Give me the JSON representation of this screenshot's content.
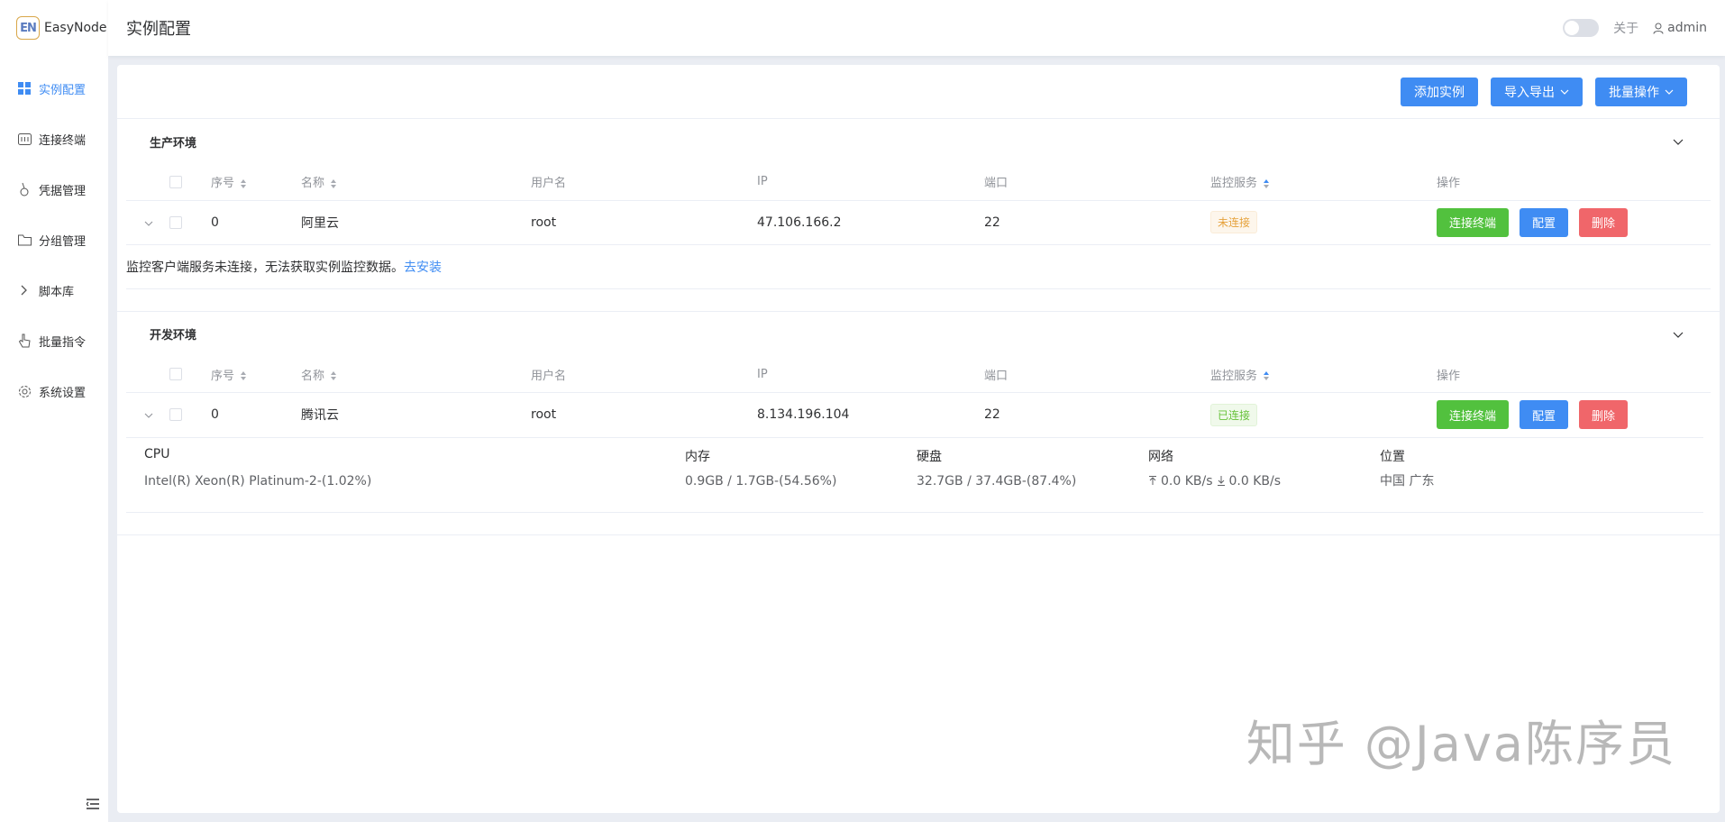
{
  "app": {
    "logo_badge": "EN",
    "name": "EasyNode"
  },
  "sidebar": {
    "items": [
      {
        "label": "实例配置",
        "icon": "grid-icon",
        "active": true
      },
      {
        "label": "连接终端",
        "icon": "terminal-icon",
        "active": false
      },
      {
        "label": "凭据管理",
        "icon": "key-icon",
        "active": false
      },
      {
        "label": "分组管理",
        "icon": "folder-icon",
        "active": false
      },
      {
        "label": "脚本库",
        "icon": "chevron-right-icon",
        "active": false
      },
      {
        "label": "批量指令",
        "icon": "pointer-icon",
        "active": false
      },
      {
        "label": "系统设置",
        "icon": "gear-icon",
        "active": false
      }
    ]
  },
  "header": {
    "title": "实例配置",
    "about": "关于",
    "user": "admin"
  },
  "toolbar": {
    "add": "添加实例",
    "import_export": "导入导出",
    "batch": "批量操作"
  },
  "columns": {
    "index": "序号",
    "name": "名称",
    "username": "用户名",
    "ip": "IP",
    "port": "端口",
    "monitor": "监控服务",
    "actions": "操作"
  },
  "actions": {
    "connect": "连接终端",
    "config": "配置",
    "delete": "删除"
  },
  "groups": [
    {
      "title": "生产环境",
      "row": {
        "index": "0",
        "name": "阿里云",
        "username": "root",
        "ip": "47.106.166.2",
        "port": "22",
        "status": "未连接"
      },
      "notice": "监控客户端服务未连接，无法获取实例监控数据。",
      "notice_link": "去安装"
    },
    {
      "title": "开发环境",
      "row": {
        "index": "0",
        "name": "腾讯云",
        "username": "root",
        "ip": "8.134.196.104",
        "port": "22",
        "status": "已连接"
      },
      "detail": {
        "cpu_label": "CPU",
        "cpu_value": "Intel(R) Xeon(R) Platinum-2-(1.02%)",
        "mem_label": "内存",
        "mem_value": "0.9GB / 1.7GB-(54.56%)",
        "disk_label": "硬盘",
        "disk_value": "32.7GB / 37.4GB-(87.4%)",
        "net_label": "网络",
        "net_up": "0.0 KB/s",
        "net_down": "0.0 KB/s",
        "loc_label": "位置",
        "loc_value": "中国 广东"
      }
    }
  ],
  "watermark": "知乎 @Java陈序员",
  "colors": {
    "primary": "#3f8cf3",
    "success": "#52c13e",
    "danger": "#f0666a",
    "warning": "#e6a23c"
  }
}
